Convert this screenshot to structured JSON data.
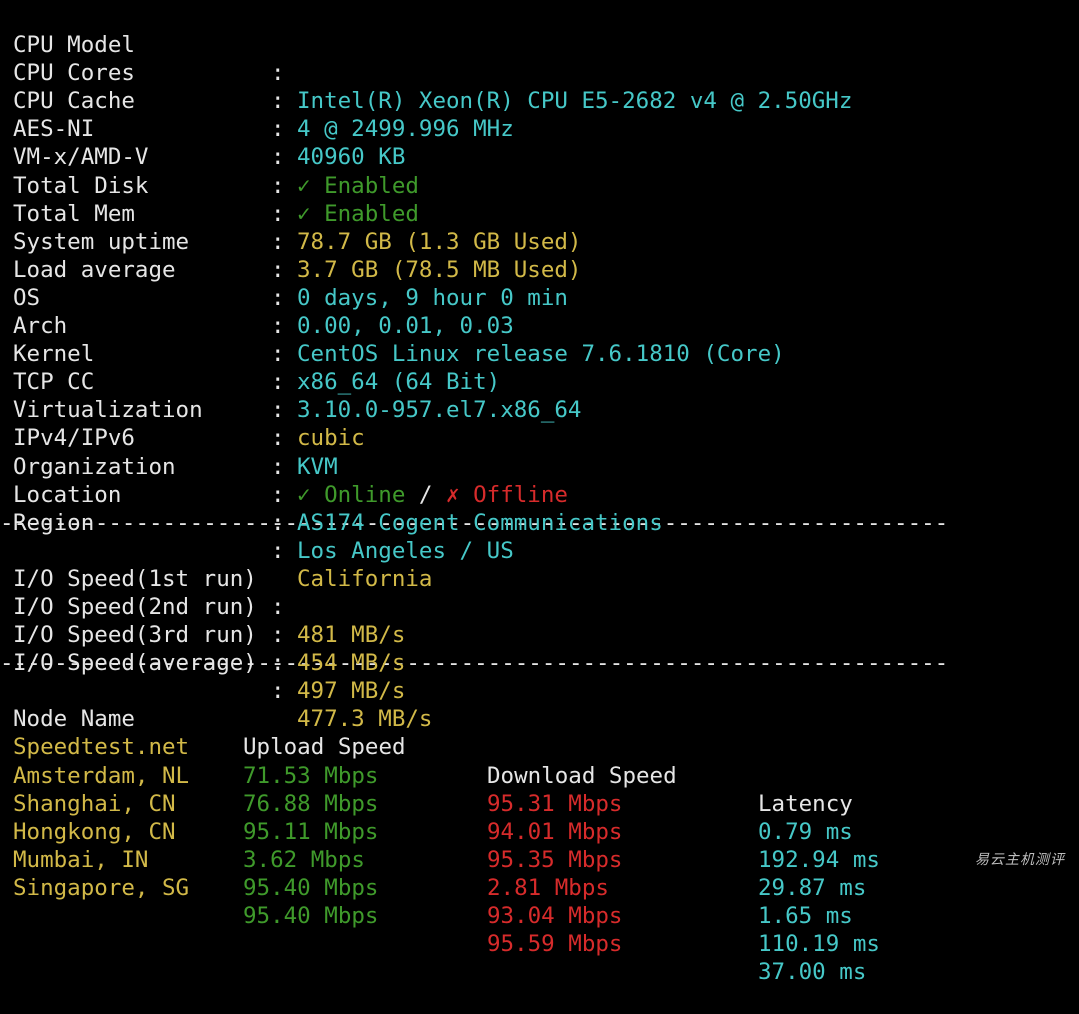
{
  "sysinfo": [
    {
      "label": "CPU Model",
      "value": "Intel(R) Xeon(R) CPU E5-2682 v4 @ 2.50GHz",
      "color": "cyan"
    },
    {
      "label": "CPU Cores",
      "value": "4 @ 2499.996 MHz",
      "color": "cyan"
    },
    {
      "label": "CPU Cache",
      "value": "40960 KB",
      "color": "cyan"
    },
    {
      "label": "AES-NI",
      "value": "✓ Enabled",
      "color": "green"
    },
    {
      "label": "VM-x/AMD-V",
      "value": "✓ Enabled",
      "color": "green"
    },
    {
      "label": "Total Disk",
      "value": "78.7 GB (1.3 GB Used)",
      "color": "yellow"
    },
    {
      "label": "Total Mem",
      "value": "3.7 GB (78.5 MB Used)",
      "color": "yellow"
    },
    {
      "label": "System uptime",
      "value": "0 days, 9 hour 0 min",
      "color": "cyan"
    },
    {
      "label": "Load average",
      "value": "0.00, 0.01, 0.03",
      "color": "cyan"
    },
    {
      "label": "OS",
      "value": "CentOS Linux release 7.6.1810 (Core)",
      "color": "cyan"
    },
    {
      "label": "Arch",
      "value": "x86_64 (64 Bit)",
      "color": "cyan"
    },
    {
      "label": "Kernel",
      "value": "3.10.0-957.el7.x86_64",
      "color": "cyan"
    },
    {
      "label": "TCP CC",
      "value": "cubic",
      "color": "yellow"
    },
    {
      "label": "Virtualization",
      "value": "KVM",
      "color": "cyan"
    }
  ],
  "ipline": {
    "label": "IPv4/IPv6",
    "online": "✓ Online",
    "slash": "/",
    "offline": "✗ Offline"
  },
  "geo": [
    {
      "label": "Organization",
      "value": "AS174 Cogent Communications",
      "color": "cyan"
    },
    {
      "label": "Location",
      "value": "Los Angeles / US",
      "color": "cyan"
    },
    {
      "label": "Region",
      "value": "California",
      "color": "yellow"
    }
  ],
  "colon": ":",
  "separator": "--------------------------------------------------------------------------",
  "io": [
    {
      "label": "I/O Speed(1st run)",
      "value": "481 MB/s"
    },
    {
      "label": "I/O Speed(2nd run)",
      "value": "454 MB/s"
    },
    {
      "label": "I/O Speed(3rd run)",
      "value": "497 MB/s"
    },
    {
      "label": "I/O Speed(average)",
      "value": "477.3 MB/s"
    }
  ],
  "speedtest": {
    "headers": [
      "Node Name",
      "Upload Speed",
      "Download Speed",
      "Latency"
    ],
    "rows": [
      {
        "node": "Speedtest.net",
        "upload": "71.53 Mbps",
        "download": "95.31 Mbps",
        "latency": "0.79 ms"
      },
      {
        "node": "Amsterdam, NL",
        "upload": "76.88 Mbps",
        "download": "94.01 Mbps",
        "latency": "192.94 ms"
      },
      {
        "node": "Shanghai, CN",
        "upload": "95.11 Mbps",
        "download": "95.35 Mbps",
        "latency": "29.87 ms"
      },
      {
        "node": "Hongkong, CN",
        "upload": "3.62 Mbps",
        "download": "2.81 Mbps",
        "latency": "1.65 ms"
      },
      {
        "node": "Mumbai, IN",
        "upload": "95.40 Mbps",
        "download": "93.04 Mbps",
        "latency": "110.19 ms"
      },
      {
        "node": "Singapore, SG",
        "upload": "95.40 Mbps",
        "download": "95.59 Mbps",
        "latency": "37.00 ms"
      }
    ]
  },
  "watermark": "易云主机测评",
  "colors": {
    "background": "#000000",
    "text": "#e6e6e6",
    "cyan": "#46c8c8",
    "yellow": "#d2b948",
    "green": "#3f9a2b",
    "red": "#d72b2b"
  }
}
